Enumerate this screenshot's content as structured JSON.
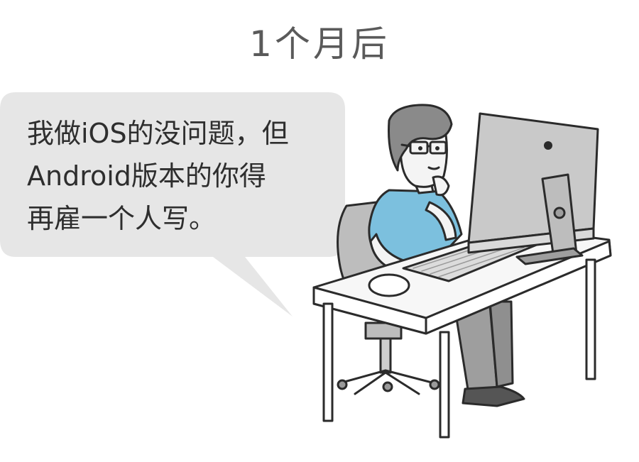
{
  "caption": "1个月后",
  "speech": {
    "lines": [
      "我做iOS的没问题，但",
      "Android版本的你得",
      "再雇一个人写。"
    ]
  },
  "colors": {
    "bubble": "#e6e6e6",
    "shirt": "#7cc0de",
    "hair": "#8a8a8a",
    "pants": "#9e9e9e",
    "monitor": "#c9c9c9"
  }
}
